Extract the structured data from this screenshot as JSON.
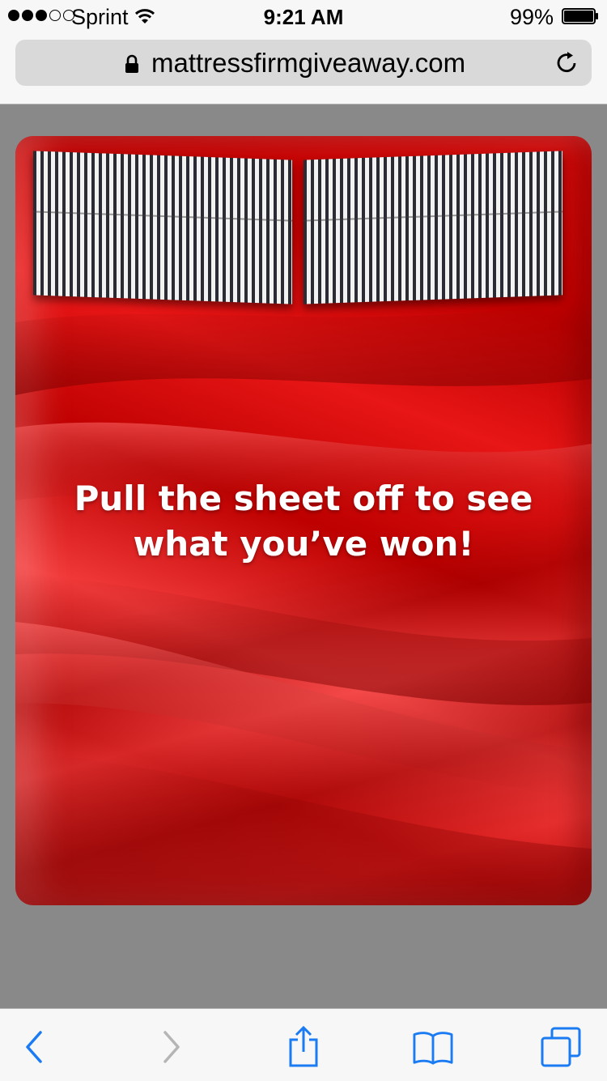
{
  "status_bar": {
    "signal_dots": [
      "full",
      "full",
      "full",
      "empty",
      "empty"
    ],
    "carrier": "Sprint",
    "time": "9:21 AM",
    "battery_percent": "99%",
    "battery_level": 0.99
  },
  "browser": {
    "url": "mattressfirmgiveaway.com",
    "icons": [
      "lock-icon",
      "reload-icon"
    ]
  },
  "card": {
    "message": "Pull the sheet off to see what you’ve won!",
    "sheet_color": "#d40a0a"
  },
  "toolbar": {
    "buttons": [
      "back-icon",
      "forward-icon",
      "share-icon",
      "bookmarks-icon",
      "tabs-icon"
    ],
    "accent_color": "#1a7bf3",
    "disabled_color": "#b5b5b5"
  }
}
